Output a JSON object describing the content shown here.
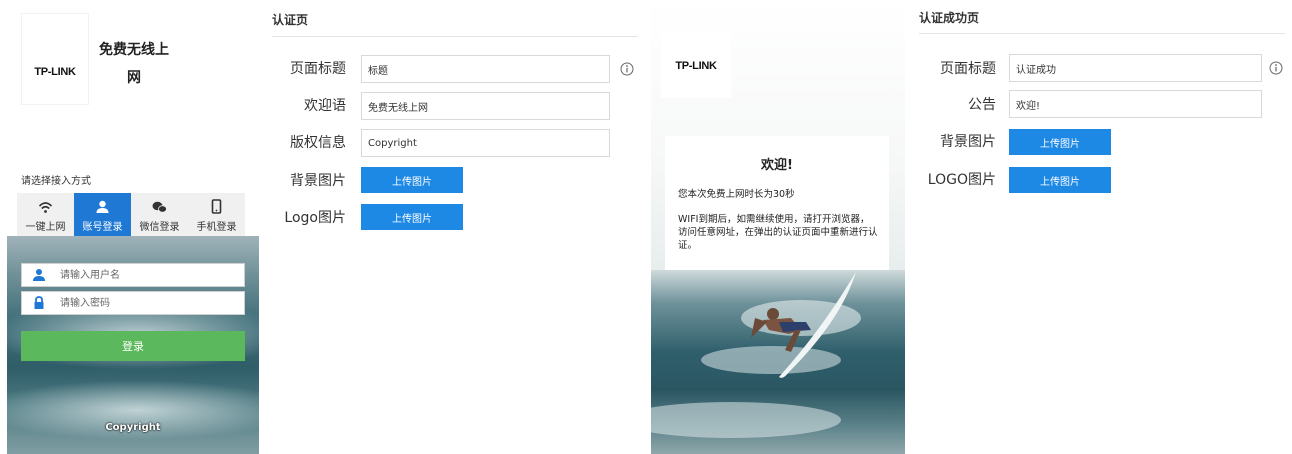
{
  "login_preview": {
    "logo_text": "TP-LINK",
    "title": "免费无线上网",
    "choose_label": "请选择接入方式",
    "methods": [
      {
        "label": "一键上网",
        "icon": "wifi-icon",
        "active": false
      },
      {
        "label": "账号登录",
        "icon": "user-icon",
        "active": true
      },
      {
        "label": "微信登录",
        "icon": "wechat-icon",
        "active": false
      },
      {
        "label": "手机登录",
        "icon": "mobile-icon",
        "active": false
      }
    ],
    "username_placeholder": "请输入用户名",
    "password_placeholder": "请输入密码",
    "login_button": "登录",
    "copyright": "Copyright"
  },
  "auth_page": {
    "section_title": "认证页",
    "fields": {
      "page_title_label": "页面标题",
      "page_title_value": "标题",
      "welcome_label": "欢迎语",
      "welcome_value": "免费无线上网",
      "copyright_label": "版权信息",
      "copyright_value": "Copyright",
      "background_label": "背景图片",
      "logo_label": "Logo图片"
    },
    "upload_button": "上传图片"
  },
  "success_preview": {
    "logo_text": "TP-LINK",
    "card_title": "欢迎!",
    "duration_text": "您本次免费上网时长为30秒",
    "notice_text": "WIFI到期后，如需继续使用，请打开浏览器，访问任意网址，在弹出的认证页面中重新进行认证。"
  },
  "success_page": {
    "section_title": "认证成功页",
    "fields": {
      "page_title_label": "页面标题",
      "page_title_value": "认证成功",
      "notice_label": "公告",
      "notice_value": "欢迎!",
      "background_label": "背景图片",
      "logo_label": "LOGO图片"
    },
    "upload_button": "上传图片"
  },
  "colors": {
    "accent_blue": "#1e88e5",
    "active_tab_blue": "#1e78d4",
    "login_green": "#5cb85c"
  }
}
